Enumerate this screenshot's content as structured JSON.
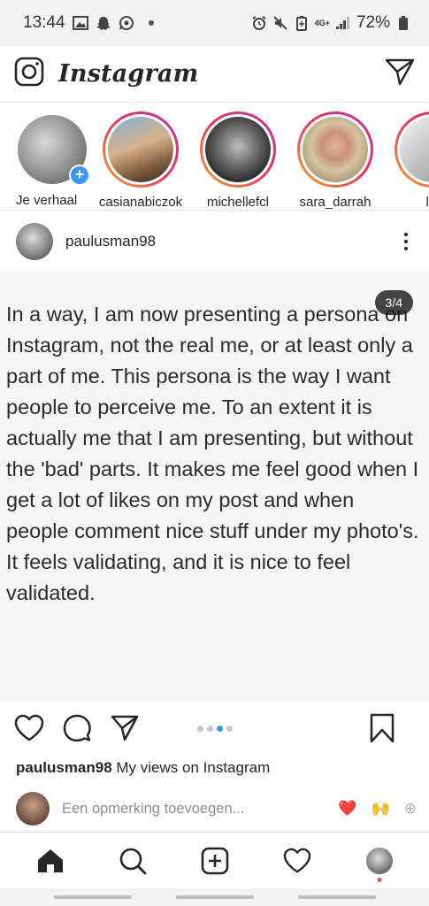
{
  "status_bar": {
    "time": "13:44",
    "network": "4G+",
    "battery": "72%",
    "icons": [
      "gallery-icon",
      "snapchat-icon",
      "whatsapp-icon",
      "alarm-icon",
      "mute-icon",
      "battery-saver-icon",
      "signal-icon",
      "battery-icon"
    ]
  },
  "header": {
    "logo": "Instagram",
    "icons": [
      "camera-icon",
      "direct-message-icon"
    ]
  },
  "stories": [
    {
      "label": "Je verhaal",
      "own": true
    },
    {
      "label": "casianabiczok"
    },
    {
      "label": "michellefcl"
    },
    {
      "label": "sara_darrah"
    },
    {
      "label": "lul"
    }
  ],
  "post": {
    "username": "paulusman98",
    "page_counter": "3/4",
    "text": "In a way, I am now presenting a persona on Instagram, not the real me, or at least only a part of me. This persona is the way I want people to perceive me. To an extent it is actually me that I am presenting, but without the 'bad' parts. It makes me feel good when I get a lot of likes on my post and when people comment nice stuff under my photo's. It feels validating, and it is nice to feel validated.",
    "caption_username": "paulusman98",
    "caption_text": "My views on Instagram",
    "comment_placeholder": "Een opmerking toevoegen...",
    "quick_reactions": [
      "❤️",
      "🙌",
      "⊕"
    ]
  },
  "colors": {
    "accent": "#3897f0",
    "story_ring_start": "#f9a52f",
    "story_ring_end": "#c12ea3",
    "notification": "#ed4956"
  }
}
